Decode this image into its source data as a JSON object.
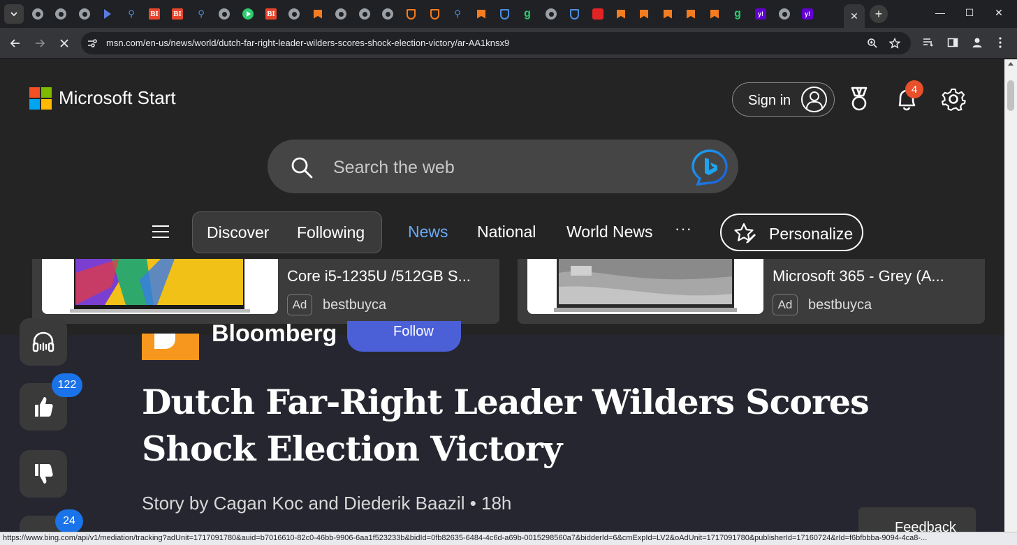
{
  "browser": {
    "url": "msn.com/en-us/news/world/dutch-far-right-leader-wilders-scores-shock-election-victory/ar-AA1knsx9",
    "status_url": "https://www.bing.com/api/v1/mediation/tracking?adUnit=1717091780&auid=b7016610-82c0-46bb-9906-6aa1f523233b&bidId=0fb82635-6484-4c6d-a69b-0015298560a7&bidderId=6&cmExpId=LV2&oAdUnit=1717091780&publisherId=17160724&rId=f6bfbbba-9094-4ca8-..."
  },
  "tabs": [
    {
      "icon": "globe-icon",
      "kind": "globe"
    },
    {
      "icon": "globe-icon",
      "kind": "globe"
    },
    {
      "icon": "globe-icon",
      "kind": "globe"
    },
    {
      "icon": "arrow-icon",
      "kind": "arrow"
    },
    {
      "icon": "magnifier-icon",
      "kind": "mag"
    },
    {
      "icon": "business-insider-icon",
      "kind": "bi",
      "text": "BI"
    },
    {
      "icon": "business-insider-icon",
      "kind": "bi",
      "text": "BI"
    },
    {
      "icon": "magnifier-icon",
      "kind": "mag"
    },
    {
      "icon": "globe-icon",
      "kind": "globe"
    },
    {
      "icon": "play-icon",
      "kind": "play"
    },
    {
      "icon": "business-insider-icon",
      "kind": "bi",
      "text": "BI"
    },
    {
      "icon": "globe-icon",
      "kind": "globe"
    },
    {
      "icon": "bookmark-icon",
      "kind": "bookmark"
    },
    {
      "icon": "globe-icon",
      "kind": "globe"
    },
    {
      "icon": "globe-icon",
      "kind": "globe"
    },
    {
      "icon": "globe-icon",
      "kind": "globe"
    },
    {
      "icon": "shield-icon",
      "kind": "shield"
    },
    {
      "icon": "shield-icon",
      "kind": "shield"
    },
    {
      "icon": "magnifier-icon",
      "kind": "mag"
    },
    {
      "icon": "bookmark-icon",
      "kind": "bookmark"
    },
    {
      "icon": "shield-icon",
      "kind": "shield-blue"
    },
    {
      "icon": "g-icon",
      "kind": "g",
      "text": "g"
    },
    {
      "icon": "globe-icon",
      "kind": "globe"
    },
    {
      "icon": "shield-icon",
      "kind": "shield-blue"
    },
    {
      "icon": "red-icon",
      "kind": "red"
    },
    {
      "icon": "bookmark-icon",
      "kind": "bookmark"
    },
    {
      "icon": "bookmark-icon",
      "kind": "bookmark"
    },
    {
      "icon": "bookmark-icon",
      "kind": "bookmark"
    },
    {
      "icon": "bookmark-icon",
      "kind": "bookmark"
    },
    {
      "icon": "bookmark-icon",
      "kind": "bookmark"
    },
    {
      "icon": "g-icon",
      "kind": "g",
      "text": "g"
    },
    {
      "icon": "yahoo-icon",
      "kind": "yahoo",
      "text": "y!"
    },
    {
      "icon": "globe-icon",
      "kind": "globe"
    },
    {
      "icon": "yahoo-icon",
      "kind": "yahoo",
      "text": "y!"
    }
  ],
  "header": {
    "brand": "Microsoft Start",
    "sign_in": "Sign in",
    "notification_count": "4",
    "logo_colors": [
      "#f25022",
      "#7fba00",
      "#00a4ef",
      "#ffb900"
    ]
  },
  "search": {
    "placeholder": "Search the web"
  },
  "nav": {
    "pills": [
      "Discover",
      "Following"
    ],
    "links": [
      "News",
      "National",
      "World News"
    ],
    "more": "···",
    "personalize": "Personalize",
    "active_color": "#6aa9f5"
  },
  "ads": [
    {
      "title": "Core i5-1235U /512GB S...",
      "badge": "Ad",
      "source": "bestbuyca"
    },
    {
      "title": "Microsoft 365 - Grey (A...",
      "badge": "Ad",
      "source": "bestbuyca"
    }
  ],
  "sidebar": {
    "like_count": "122",
    "comment_count": "24"
  },
  "article": {
    "publisher": "Bloomberg",
    "follow": "Follow",
    "headline": "Dutch Far-Right Leader Wilders Scores Shock Election Victory",
    "byline": "Story by Cagan Koc and Diederik Baazil  •  18h",
    "feedback": "Feedback"
  }
}
